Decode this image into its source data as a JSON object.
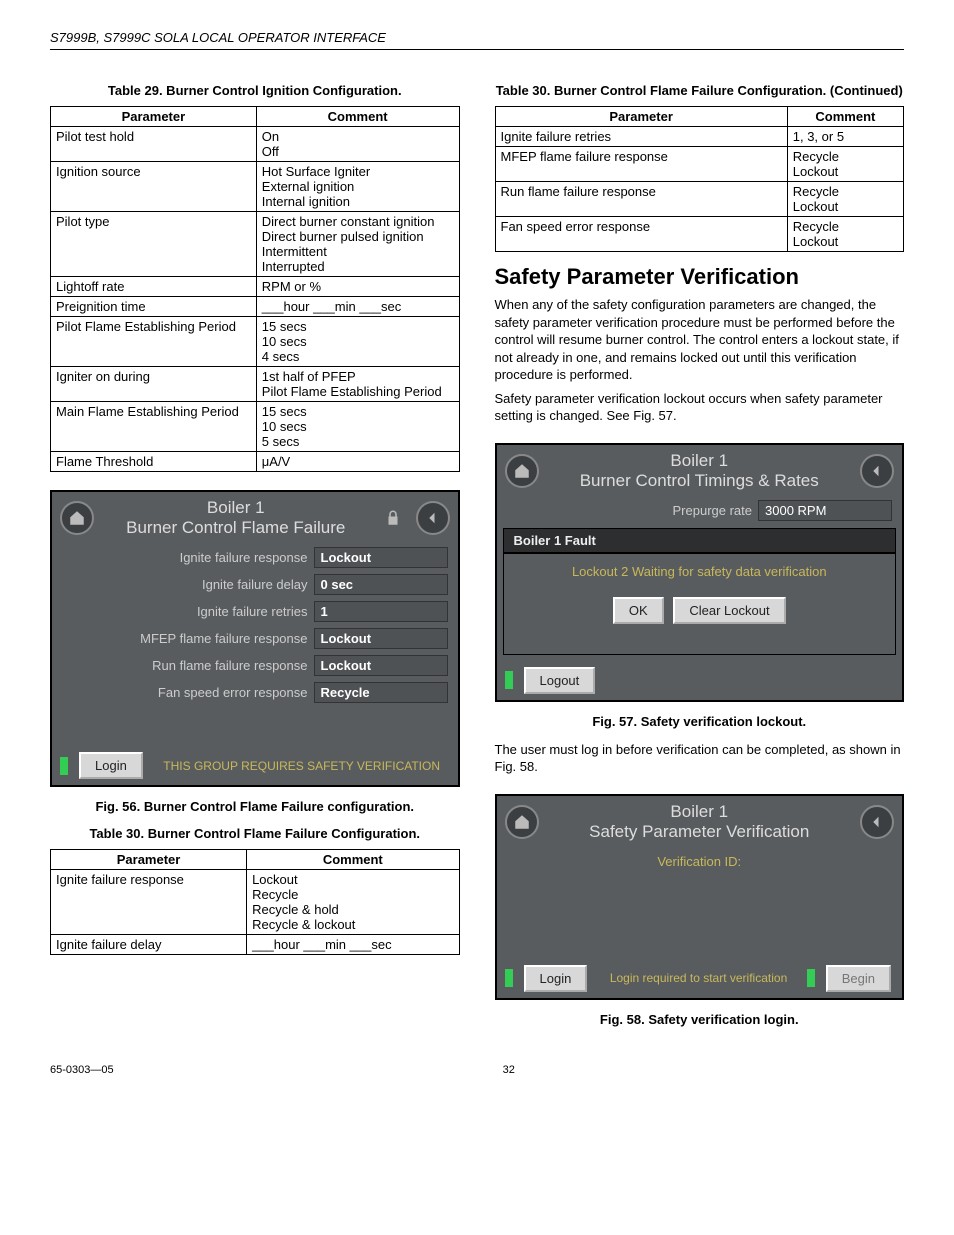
{
  "header": "S7999B, S7999C SOLA LOCAL OPERATOR INTERFACE",
  "footer": {
    "left": "65-0303—05",
    "center": "32"
  },
  "t29": {
    "cap": "Table 29. Burner Control Ignition Configuration.",
    "head": [
      "Parameter",
      "Comment"
    ],
    "rows": [
      [
        "Pilot test hold",
        "On\nOff"
      ],
      [
        "Ignition source",
        "Hot Surface Igniter\nExternal ignition\nInternal ignition"
      ],
      [
        "Pilot type",
        "Direct burner constant ignition\nDirect burner pulsed ignition\nIntermittent\nInterrupted"
      ],
      [
        "Lightoff rate",
        "RPM or %"
      ],
      [
        "Preignition time",
        "___hour ___min ___sec"
      ],
      [
        "Pilot Flame Establishing Period",
        "15 secs\n10 secs\n4 secs"
      ],
      [
        "Igniter on during",
        "1st half of PFEP\nPilot Flame Establishing Period"
      ],
      [
        "Main Flame Establishing Period",
        "15 secs\n10 secs\n5 secs"
      ],
      [
        "Flame Threshold",
        "μA/V"
      ]
    ]
  },
  "fig56": {
    "title_l1": "Boiler 1",
    "title_l2": "Burner Control Flame Failure",
    "rows": [
      [
        "Ignite failure response",
        "Lockout",
        true
      ],
      [
        "Ignite failure delay",
        "0 sec",
        true
      ],
      [
        "Ignite failure retries",
        "1",
        true
      ],
      [
        "MFEP flame failure response",
        "Lockout",
        true
      ],
      [
        "Run flame failure response",
        "Lockout",
        true
      ],
      [
        "Fan speed error response",
        "Recycle",
        true
      ]
    ],
    "login": "Login",
    "msg": "THIS GROUP REQUIRES SAFETY VERIFICATION",
    "cap": "Fig. 56. Burner Control Flame Failure configuration."
  },
  "t30a": {
    "cap": "Table 30. Burner Control Flame Failure Configuration.",
    "head": [
      "Parameter",
      "Comment"
    ],
    "rows": [
      [
        "Ignite failure response",
        "Lockout\nRecycle\nRecycle & hold\nRecycle & lockout"
      ],
      [
        "Ignite failure delay",
        "___hour ___min ___sec"
      ]
    ]
  },
  "t30b": {
    "cap": "Table 30. Burner Control Flame Failure Configuration. (Continued)",
    "head": [
      "Parameter",
      "Comment"
    ],
    "rows": [
      [
        "Ignite failure retries",
        "1, 3, or 5"
      ],
      [
        "MFEP flame failure response",
        "Recycle\nLockout"
      ],
      [
        "Run flame failure response",
        "Recycle\nLockout"
      ],
      [
        "Fan speed error response",
        "Recycle\nLockout"
      ]
    ]
  },
  "spv": {
    "h": "Safety Parameter Verification",
    "p1": "When any of the safety configuration parameters are changed, the safety parameter verification procedure must be performed before the control will resume burner control. The control enters a lockout state, if not already in one, and remains locked out until this verification procedure is performed.",
    "p2": "Safety parameter verification lockout occurs when safety parameter setting is changed. See Fig. 57."
  },
  "fig57": {
    "title_l1": "Boiler 1",
    "title_l2": "Burner Control Timings & Rates",
    "row_lbl": "Prepurge rate",
    "row_val": "3000 RPM",
    "fault_h": "Boiler 1 Fault",
    "fault_msg": "Lockout 2  Waiting for safety data verification",
    "ok": "OK",
    "clear": "Clear Lockout",
    "logout": "Logout",
    "cap": "Fig. 57. Safety verification lockout."
  },
  "midp": "The user must log in before verification can be completed, as shown in Fig. 58.",
  "fig58": {
    "title_l1": "Boiler 1",
    "title_l2": "Safety Parameter Verification",
    "lbl": "Verification ID:",
    "login": "Login",
    "begin": "Begin",
    "msg": "Login required to start verification",
    "cap": "Fig. 58. Safety verification login."
  }
}
